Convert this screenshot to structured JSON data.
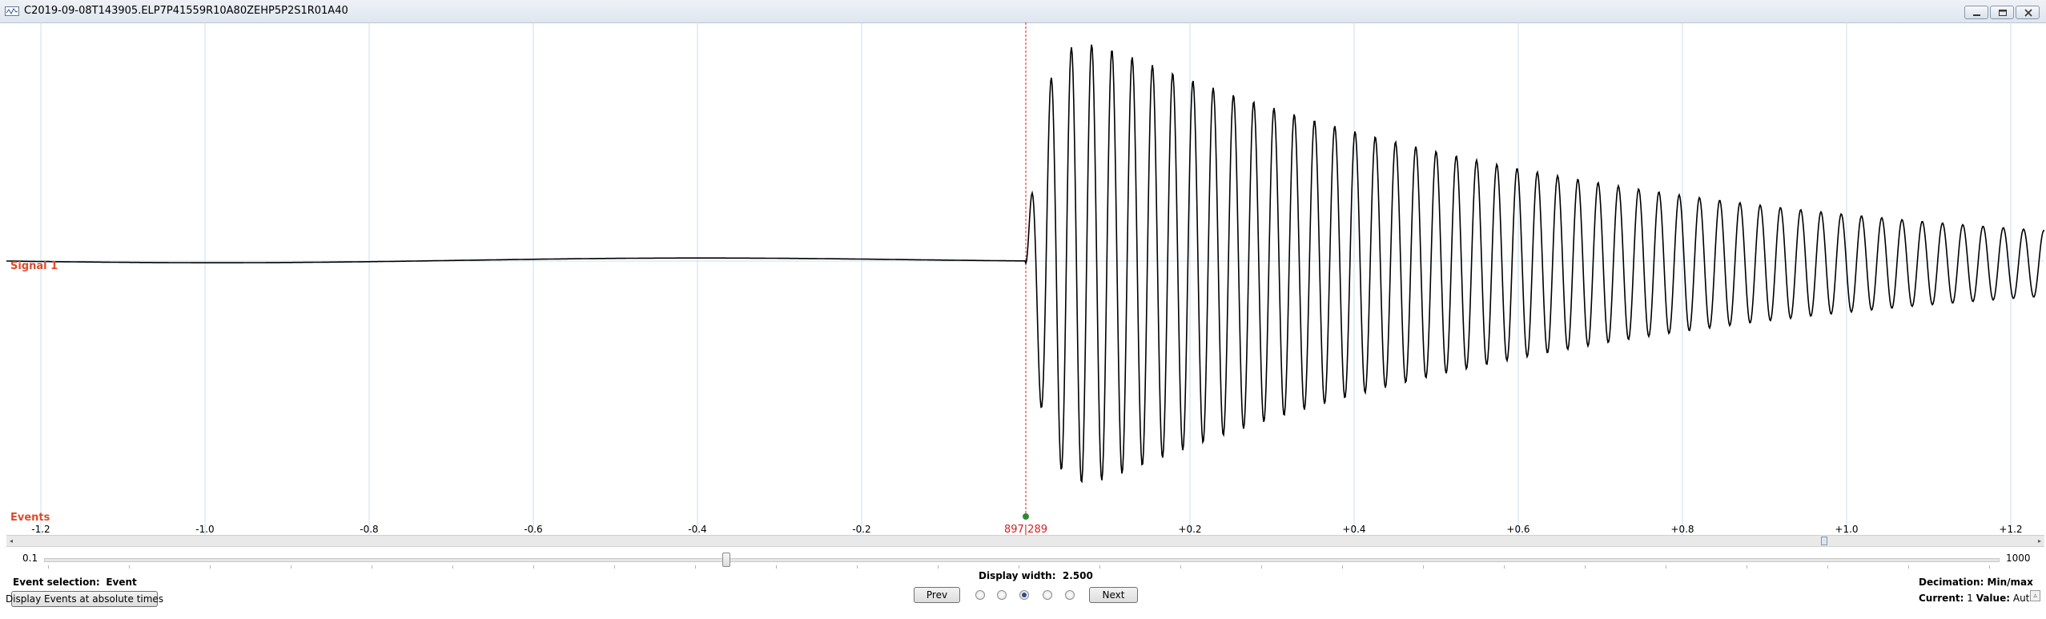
{
  "window": {
    "title": "C2019-09-08T143905.ELP7P41559R10A80ZEHP5P2S1R01A40",
    "controls": [
      "minimize-icon",
      "maximize-icon",
      "close-icon"
    ]
  },
  "plot": {
    "signal_label": "Signal 1",
    "events_label": "Events",
    "event_marker_label": "897|289",
    "x_tick_labels": [
      "-1.2",
      "-1.0",
      "-0.8",
      "-0.6",
      "-0.4",
      "-0.2",
      "+0.2",
      "+0.4",
      "+0.6",
      "+0.8",
      "+1.0",
      "+1.2"
    ],
    "x_tick_values": [
      -1.2,
      -1.0,
      -0.8,
      -0.6,
      -0.4,
      -0.2,
      0.2,
      0.4,
      0.6,
      0.8,
      1.0,
      1.2
    ],
    "colors": {
      "grid": "#c9dff2",
      "signal": "#000000",
      "label": "#e04a2a",
      "event_marker": "#d42020",
      "event_point": "#2f8a2f"
    }
  },
  "chart_data": {
    "type": "line",
    "title": "",
    "xlabel": "",
    "ylabel": "",
    "xlim": [
      -1.25,
      1.25
    ],
    "series": [
      {
        "name": "Signal 1",
        "description": "flat baseline before event at t=0, then damped oscillation",
        "event_time": 0,
        "oscillation_frequency_per_unit": 50
      }
    ]
  },
  "zoom": {
    "min": "0.1",
    "max": "1000"
  },
  "footer": {
    "event_selection_label": "Event selection:",
    "event_selection_value": "Event",
    "display_events_button": "Display Events at absolute times",
    "display_width_label": "Display width:",
    "display_width_value": "2.500",
    "prev_button": "Prev",
    "next_button": "Next",
    "radio_count": 5,
    "radio_selected_index": 2,
    "decimation": "Decimation: Min/max",
    "current_label": "Current:",
    "current_value": "1",
    "value_label": "Value:",
    "value_value": "Auto"
  }
}
